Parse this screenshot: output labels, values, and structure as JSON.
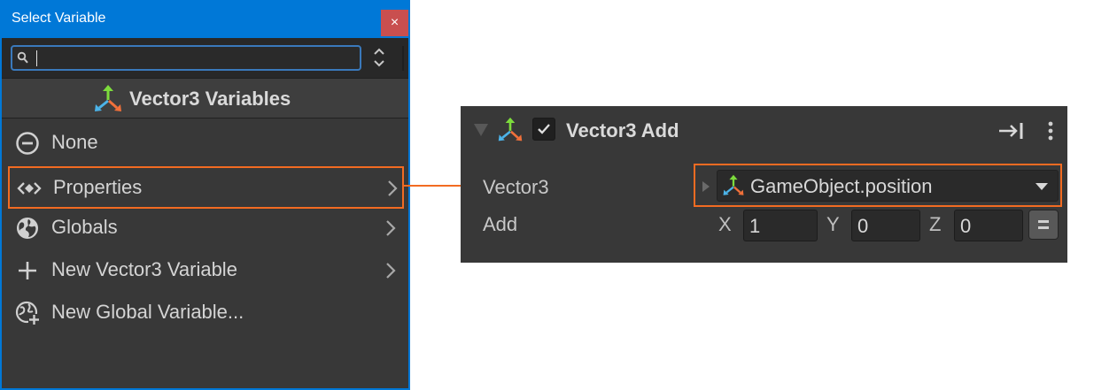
{
  "window": {
    "title": "Select Variable",
    "close_glyph": "×",
    "search": {
      "value": "",
      "placeholder": ""
    },
    "header": "Vector3 Variables",
    "items": [
      {
        "label": "None",
        "icon": "none-circle-icon",
        "submenu": false
      },
      {
        "label": "Properties",
        "icon": "properties-icon",
        "submenu": true,
        "selected": true
      },
      {
        "label": "Globals",
        "icon": "globe-icon",
        "submenu": true
      },
      {
        "label": "New Vector3 Variable",
        "icon": "plus-icon",
        "submenu": true
      },
      {
        "label": "New Global Variable...",
        "icon": "globe-plus-icon",
        "submenu": false
      }
    ]
  },
  "inspector": {
    "title": "Vector3 Add",
    "enabled": true,
    "fields": {
      "vector3_label": "Vector3",
      "vector3_value": "GameObject.position",
      "add_label": "Add",
      "x_label": "X",
      "x_value": "1",
      "y_label": "Y",
      "y_value": "0",
      "z_label": "Z",
      "z_value": "0"
    }
  },
  "colors": {
    "titlebar": "#0078d7",
    "highlight": "#f26b22",
    "panel": "#383838",
    "close": "#c94f4f"
  }
}
